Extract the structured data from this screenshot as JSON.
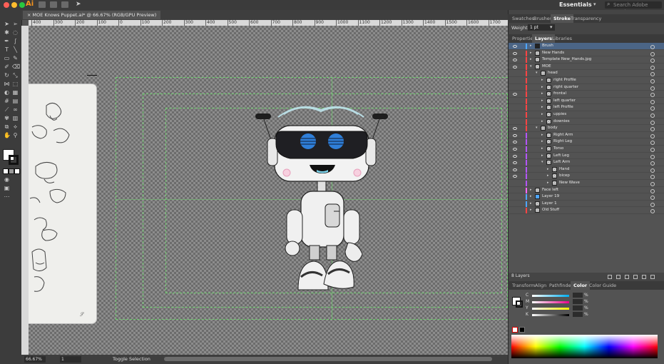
{
  "menubar": {
    "app_label": "Ai",
    "workspace": "Essentials",
    "search_placeholder": "Search Adobe Stock"
  },
  "document": {
    "tab_title": "MOE Knows Puppet.ai* @ 66.67% (RGB/GPU Preview)",
    "close_glyph": "×"
  },
  "ruler": {
    "ticks": [
      "400",
      "300",
      "200",
      "100",
      "0",
      "100",
      "200",
      "300",
      "400",
      "500",
      "600",
      "700",
      "800",
      "900",
      "1000",
      "1100",
      "1200",
      "1300",
      "1400",
      "1500",
      "1600",
      "1700"
    ]
  },
  "statusbar": {
    "zoom": "66.67%",
    "page": "1",
    "status": "Toggle Selection"
  },
  "stroke_panel": {
    "tabs": [
      "Swatches",
      "Brushes",
      "Stroke",
      "Transparency"
    ],
    "active_tab": "Stroke",
    "weight_label": "Weight:",
    "weight_value": "1 pt"
  },
  "layers_panel": {
    "tabs": [
      "Properties",
      "Layers",
      "Libraries"
    ],
    "active_tab": "Layers",
    "count_label": "8 Layers",
    "rows": [
      {
        "name": "Brush",
        "indent": 0,
        "eye": true,
        "selected": true,
        "color": "#4fa6ff",
        "thumb": "dark"
      },
      {
        "name": "New Hands",
        "indent": 0,
        "eye": true,
        "selected": false,
        "color": "#ff4444",
        "thumb": "check"
      },
      {
        "name": "Template New_Hands.jpg",
        "indent": 0,
        "eye": true,
        "selected": false,
        "color": "#ff4444",
        "thumb": "check"
      },
      {
        "name": "MOE",
        "indent": 0,
        "eye": true,
        "selected": false,
        "color": "#ff4444",
        "thumb": "check",
        "expanded": true
      },
      {
        "name": "head",
        "indent": 1,
        "eye": false,
        "selected": false,
        "color": "#ff4444",
        "thumb": "check",
        "expanded": true
      },
      {
        "name": "right Profile",
        "indent": 2,
        "eye": false,
        "selected": false,
        "color": "#ff4444",
        "thumb": "check"
      },
      {
        "name": "right quarter",
        "indent": 2,
        "eye": false,
        "selected": false,
        "color": "#ff4444",
        "thumb": "check"
      },
      {
        "name": "frontal",
        "indent": 2,
        "eye": true,
        "selected": false,
        "color": "#ff4444",
        "thumb": "check"
      },
      {
        "name": "left quarter",
        "indent": 2,
        "eye": false,
        "selected": false,
        "color": "#ff4444",
        "thumb": "check"
      },
      {
        "name": "left Profile",
        "indent": 2,
        "eye": false,
        "selected": false,
        "color": "#ff4444",
        "thumb": "check"
      },
      {
        "name": "uppies",
        "indent": 2,
        "eye": false,
        "selected": false,
        "color": "#ff4444",
        "thumb": "check"
      },
      {
        "name": "downies",
        "indent": 2,
        "eye": false,
        "selected": false,
        "color": "#ff4444",
        "thumb": "check"
      },
      {
        "name": "body",
        "indent": 1,
        "eye": true,
        "selected": false,
        "color": "#ff4444",
        "thumb": "check",
        "expanded": true
      },
      {
        "name": "Right Arm",
        "indent": 2,
        "eye": true,
        "selected": false,
        "color": "#b455ff",
        "thumb": "check"
      },
      {
        "name": "Right Leg",
        "indent": 2,
        "eye": true,
        "selected": false,
        "color": "#b455ff",
        "thumb": "check"
      },
      {
        "name": "Torso",
        "indent": 2,
        "eye": true,
        "selected": false,
        "color": "#b455ff",
        "thumb": "check"
      },
      {
        "name": "Left Leg",
        "indent": 2,
        "eye": true,
        "selected": false,
        "color": "#b455ff",
        "thumb": "check"
      },
      {
        "name": "Left Arm",
        "indent": 2,
        "eye": true,
        "selected": false,
        "color": "#b455ff",
        "thumb": "check",
        "expanded": true
      },
      {
        "name": "Hand",
        "indent": 3,
        "eye": true,
        "selected": false,
        "color": "#b455ff",
        "thumb": "check"
      },
      {
        "name": "bicep",
        "indent": 3,
        "eye": true,
        "selected": false,
        "color": "#b455ff",
        "thumb": "check"
      },
      {
        "name": "New Wave",
        "indent": 3,
        "eye": false,
        "selected": false,
        "color": "#b455ff",
        "thumb": "check"
      },
      {
        "name": "Face left",
        "indent": 0,
        "eye": false,
        "selected": false,
        "color": "#ff66ff",
        "thumb": "check"
      },
      {
        "name": "Layer 19",
        "indent": 0,
        "eye": false,
        "selected": false,
        "color": "#4fa6ff",
        "thumb": "blue"
      },
      {
        "name": "Layer 1",
        "indent": 0,
        "eye": false,
        "selected": false,
        "color": "#4fa6ff",
        "thumb": "check"
      },
      {
        "name": "Old Stuff",
        "indent": 0,
        "eye": false,
        "selected": false,
        "color": "#ff4444",
        "thumb": "check"
      }
    ]
  },
  "color_panel": {
    "tabs": [
      "Transform",
      "Align",
      "Pathfinder",
      "Color",
      "Color Guide"
    ],
    "active_tab": "Color",
    "channels": [
      {
        "label": "C",
        "value": "%",
        "gradient": "#00aeef"
      },
      {
        "label": "M",
        "value": "%",
        "gradient": "#ec008c"
      },
      {
        "label": "Y",
        "value": "%",
        "gradient": "#fff200"
      },
      {
        "label": "K",
        "value": "%",
        "gradient": "#000000"
      }
    ]
  },
  "colors": {
    "guide_green": "#6fd36f",
    "selected_layer": "#4b6586",
    "robot_eyes": "#2f7fd9"
  }
}
